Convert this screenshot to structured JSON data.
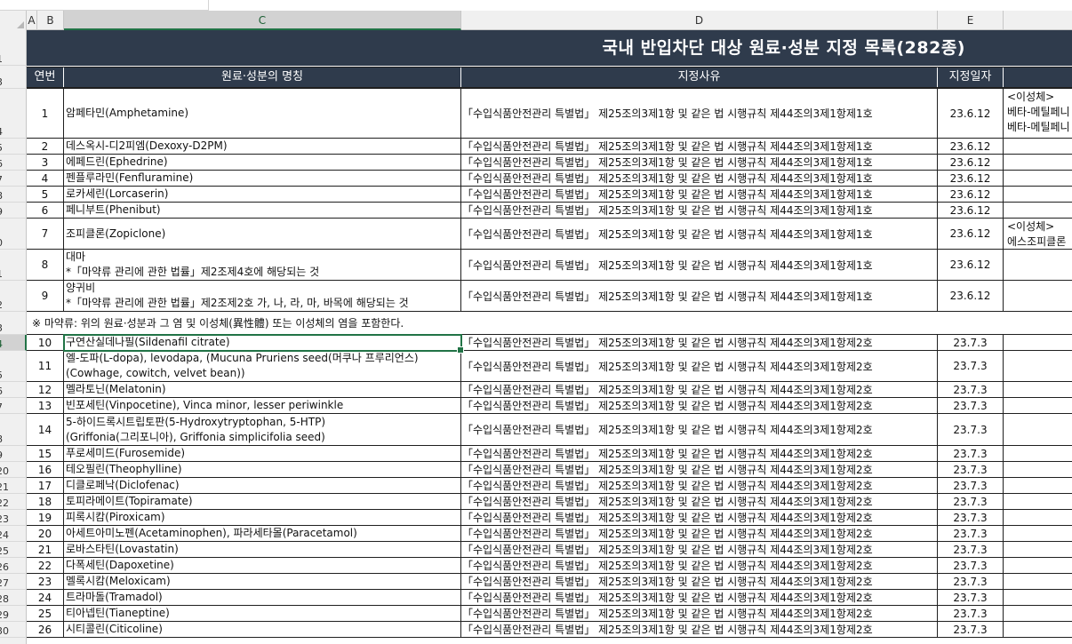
{
  "column_headers": [
    "A",
    "B",
    "C",
    "D",
    "E"
  ],
  "row_headers": [
    "1",
    "3",
    "4",
    "5",
    "6",
    "7",
    "8",
    "9",
    "0",
    "1",
    "2",
    "3",
    "4",
    "5",
    "6",
    "7",
    "8",
    "9",
    "20",
    "21",
    "22",
    "23",
    "24",
    "25",
    "26",
    "27",
    "28",
    "29",
    "30"
  ],
  "sheet": {
    "title": "국내 반입차단 대상 원료·성분 지정 목록(282종)",
    "headers": {
      "no": "연번",
      "name": "원료·성분의 명칭",
      "reason": "지정사유",
      "date": "지정일자"
    },
    "rows": [
      {
        "no": "1",
        "name": [
          "암페타민(Amphetamine)"
        ],
        "reason": "「수입식품안전관리 특별법」 제25조의3제1항 및 같은 법 시행규칙 제44조의3제1항제1호",
        "date": "23.6.12",
        "note": [
          "<이성체>",
          "베타-메틸페니",
          "베타-메틸페니"
        ]
      },
      {
        "no": "2",
        "name": [
          "데스옥시-디2피엠(Dexoxy-D2PM)"
        ],
        "reason": "「수입식품안전관리 특별법」 제25조의3제1항 및 같은 법 시행규칙 제44조의3제1항제1호",
        "date": "23.6.12",
        "note": []
      },
      {
        "no": "3",
        "name": [
          "에페드린(Ephedrine)"
        ],
        "reason": "「수입식품안전관리 특별법」 제25조의3제1항 및 같은 법 시행규칙 제44조의3제1항제1호",
        "date": "23.6.12",
        "note": []
      },
      {
        "no": "4",
        "name": [
          "펜플루라민(Fenfluramine)"
        ],
        "reason": "「수입식품안전관리 특별법」 제25조의3제1항 및 같은 법 시행규칙 제44조의3제1항제1호",
        "date": "23.6.12",
        "note": []
      },
      {
        "no": "5",
        "name": [
          "로카세린(Lorcaserin)"
        ],
        "reason": "「수입식품안전관리 특별법」 제25조의3제1항 및 같은 법 시행규칙 제44조의3제1항제1호",
        "date": "23.6.12",
        "note": []
      },
      {
        "no": "6",
        "name": [
          "페니부트(Phenibut)"
        ],
        "reason": "「수입식품안전관리 특별법」 제25조의3제1항 및 같은 법 시행규칙 제44조의3제1항제1호",
        "date": "23.6.12",
        "note": []
      },
      {
        "no": "7",
        "name": [
          "조피클론(Zopiclone)"
        ],
        "reason": "「수입식품안전관리 특별법」 제25조의3제1항 및 같은 법 시행규칙 제44조의3제1항제1호",
        "date": "23.6.12",
        "note": [
          "<이성체>",
          "에스조피클론"
        ]
      },
      {
        "no": "8",
        "name": [
          "대마",
          "*「마약류 관리에 관한 법률」제2조제4호에 해당되는 것"
        ],
        "reason": "「수입식품안전관리 특별법」 제25조의3제1항 및 같은 법 시행규칙 제44조의3제1항제1호",
        "date": "23.6.12",
        "note": []
      },
      {
        "no": "9",
        "name": [
          "양귀비",
          "*「마약류 관리에 관한 법률」제2조제2호 가, 나, 라, 마, 바목에 해당되는 것"
        ],
        "reason": "「수입식품안전관리 특별법」 제25조의3제1항 및 같은 법 시행규칙 제44조의3제1항제1호",
        "date": "23.6.12",
        "note": []
      }
    ],
    "footnote": "※ 마약류: 위의 원료·성분과 그 염 및 이성체(異性體) 또는 이성체의 염을 포함한다.",
    "rows2": [
      {
        "no": "10",
        "name": [
          "구연산실데나필(Sildenafil citrate)"
        ],
        "reason": "「수입식품안전관리 특별법」 제25조의3제1항 및 같은 법 시행규칙 제44조의3제1항제2호",
        "date": "23.7.3"
      },
      {
        "no": "11",
        "name": [
          "엘-도파(L-dopa), levodapa, (Mucuna Pruriens seed(머쿠나 프루리언스)",
          "(Cowhage, cowitch, velvet bean))"
        ],
        "reason": "「수입식품안전관리 특별법」 제25조의3제1항 및 같은 법 시행규칙 제44조의3제1항제2호",
        "date": "23.7.3"
      },
      {
        "no": "12",
        "name": [
          "멜라토닌(Melatonin)"
        ],
        "reason": "「수입식품안전관리 특별법」 제25조의3제1항 및 같은 법 시행규칙 제44조의3제1항제2호",
        "date": "23.7.3"
      },
      {
        "no": "13",
        "name": [
          "빈포세틴(Vinpocetine), Vinca minor, lesser periwinkle"
        ],
        "reason": "「수입식품안전관리 특별법」 제25조의3제1항 및 같은 법 시행규칙 제44조의3제1항제2호",
        "date": "23.7.3"
      },
      {
        "no": "14",
        "name": [
          "5-하이드록시트립토판(5-Hydroxytryptophan, 5-HTP)",
          "(Griffonia(그리포니아), Griffonia simplicifolia seed)"
        ],
        "reason": "「수입식품안전관리 특별법」 제25조의3제1항 및 같은 법 시행규칙 제44조의3제1항제2호",
        "date": "23.7.3"
      },
      {
        "no": "15",
        "name": [
          "푸로세미드(Furosemide)"
        ],
        "reason": "「수입식품안전관리 특별법」 제25조의3제1항 및 같은 법 시행규칙 제44조의3제1항제2호",
        "date": "23.7.3"
      },
      {
        "no": "16",
        "name": [
          "테오필린(Theophylline)"
        ],
        "reason": "「수입식품안전관리 특별법」 제25조의3제1항 및 같은 법 시행규칙 제44조의3제1항제2호",
        "date": "23.7.3"
      },
      {
        "no": "17",
        "name": [
          "디클로페낙(Diclofenac)"
        ],
        "reason": "「수입식품안전관리 특별법」 제25조의3제1항 및 같은 법 시행규칙 제44조의3제1항제2호",
        "date": "23.7.3"
      },
      {
        "no": "18",
        "name": [
          "토피라메이트(Topiramate)"
        ],
        "reason": "「수입식품안전관리 특별법」 제25조의3제1항 및 같은 법 시행규칙 제44조의3제1항제2호",
        "date": "23.7.3"
      },
      {
        "no": "19",
        "name": [
          "피록시캄(Piroxicam)"
        ],
        "reason": "「수입식품안전관리 특별법」 제25조의3제1항 및 같은 법 시행규칙 제44조의3제1항제2호",
        "date": "23.7.3"
      },
      {
        "no": "20",
        "name": [
          "아세트아미노펜(Acetaminophen), 파라세타몰(Paracetamol)"
        ],
        "reason": "「수입식품안전관리 특별법」 제25조의3제1항 및 같은 법 시행규칙 제44조의3제1항제2호",
        "date": "23.7.3"
      },
      {
        "no": "21",
        "name": [
          "로바스타틴(Lovastatin)"
        ],
        "reason": "「수입식품안전관리 특별법」 제25조의3제1항 및 같은 법 시행규칙 제44조의3제1항제2호",
        "date": "23.7.3"
      },
      {
        "no": "22",
        "name": [
          "다폭세틴(Dapoxetine)"
        ],
        "reason": "「수입식품안전관리 특별법」 제25조의3제1항 및 같은 법 시행규칙 제44조의3제1항제2호",
        "date": "23.7.3"
      },
      {
        "no": "23",
        "name": [
          "멜록시캄(Meloxicam)"
        ],
        "reason": "「수입식품안전관리 특별법」 제25조의3제1항 및 같은 법 시행규칙 제44조의3제1항제2호",
        "date": "23.7.3"
      },
      {
        "no": "24",
        "name": [
          "트라마돌(Tramadol)"
        ],
        "reason": "「수입식품안전관리 특별법」 제25조의3제1항 및 같은 법 시행규칙 제44조의3제1항제2호",
        "date": "23.7.3"
      },
      {
        "no": "25",
        "name": [
          "티아넵틴(Tianeptine)"
        ],
        "reason": "「수입식품안전관리 특별법」 제25조의3제1항 및 같은 법 시행규칙 제44조의3제1항제2호",
        "date": "23.7.3"
      },
      {
        "no": "26",
        "name": [
          "시티콜린(Citicoline)"
        ],
        "reason": "「수입식품안전관리 특별법」 제25조의3제1항 및 같은 법 시행규칙 제44조의3제1항제2호",
        "date": "23.7.3"
      }
    ]
  }
}
